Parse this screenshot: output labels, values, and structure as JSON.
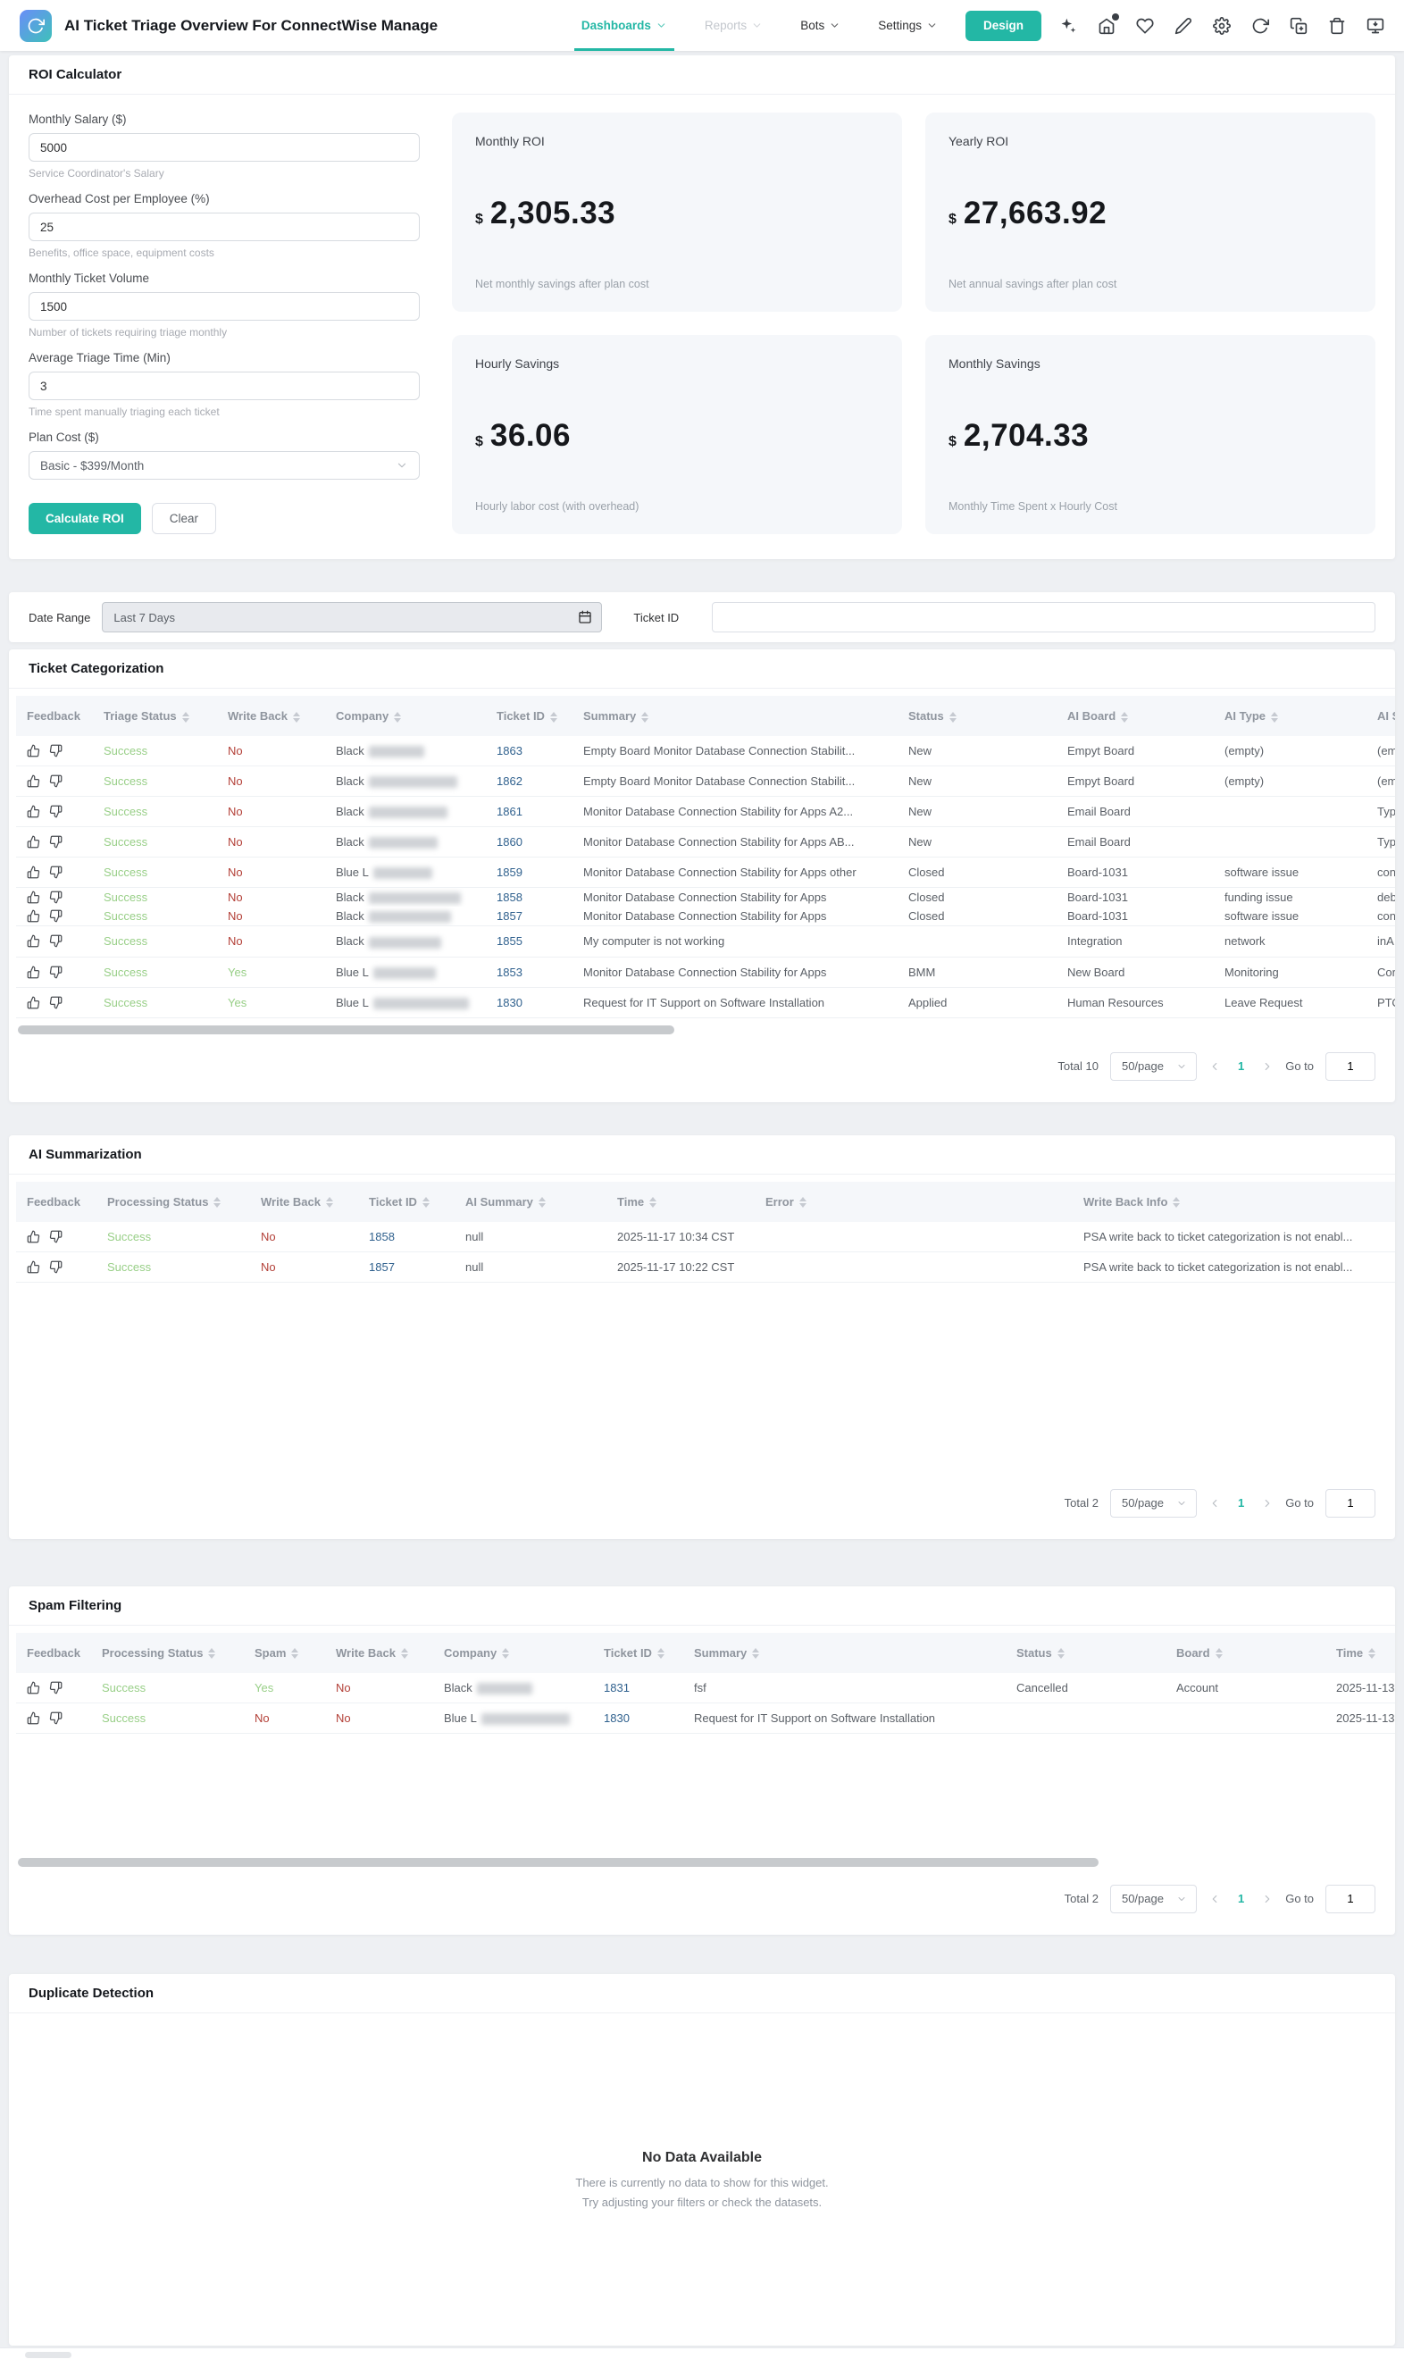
{
  "nav": {
    "title": "AI Ticket Triage Overview For ConnectWise Manage",
    "menus": [
      {
        "label": "Dashboards",
        "state": "active"
      },
      {
        "label": "Reports",
        "state": "disabled"
      },
      {
        "label": "Bots",
        "state": "normal"
      },
      {
        "label": "Settings",
        "state": "normal"
      }
    ],
    "design_button": "Design",
    "icons": [
      "ai-sparkles",
      "home",
      "favorite",
      "edit",
      "settings",
      "refresh",
      "duplicate",
      "trash",
      "present"
    ]
  },
  "roi": {
    "title": "ROI Calculator",
    "fields": [
      {
        "label": "Monthly Salary ($)",
        "value": "5000",
        "helper": "Service Coordinator's Salary"
      },
      {
        "label": "Overhead Cost per Employee (%)",
        "value": "25",
        "helper": "Benefits, office space, equipment costs"
      },
      {
        "label": "Monthly Ticket Volume",
        "value": "1500",
        "helper": "Number of tickets requiring triage monthly"
      },
      {
        "label": "Average Triage Time (Min)",
        "value": "3",
        "helper": "Time spent manually triaging each ticket"
      }
    ],
    "plan": {
      "label": "Plan Cost ($)",
      "value": "Basic - $399/Month"
    },
    "calculate_button": "Calculate ROI",
    "clear_button": "Clear",
    "metrics": [
      {
        "title": "Monthly ROI",
        "currency": "$",
        "value": "2,305.33",
        "caption": "Net monthly savings after plan cost"
      },
      {
        "title": "Yearly ROI",
        "currency": "$",
        "value": "27,663.92",
        "caption": "Net annual savings after plan cost"
      },
      {
        "title": "Hourly Savings",
        "currency": "$",
        "value": "36.06",
        "caption": "Hourly labor cost (with overhead)"
      },
      {
        "title": "Monthly Savings",
        "currency": "$",
        "value": "2,704.33",
        "caption": "Monthly Time Spent x Hourly Cost"
      }
    ]
  },
  "filters": {
    "date_range_label": "Date Range",
    "date_range_value": "Last 7 Days",
    "ticket_id_label": "Ticket ID",
    "ticket_id_value": ""
  },
  "ticket_categorization": {
    "title": "Ticket Categorization",
    "columns": [
      "Feedback",
      "Triage Status",
      "Write Back",
      "Company",
      "Ticket ID",
      "Summary",
      "Status",
      "AI Board",
      "AI Type",
      "AI S"
    ],
    "rows": [
      {
        "triage_status": "Success",
        "write_back": "No",
        "company": "Black",
        "ticket_id": "1863",
        "summary": "Empty Board Monitor Database Connection Stabilit...",
        "status": "New",
        "ai_board": "Empyt Board",
        "ai_type": "(empty)",
        "ai_s": "(em"
      },
      {
        "triage_status": "Success",
        "write_back": "No",
        "company": "Black",
        "ticket_id": "1862",
        "summary": "Empty Board Monitor Database Connection Stabilit...",
        "status": "New",
        "ai_board": "Empyt Board",
        "ai_type": "(empty)",
        "ai_s": "(em"
      },
      {
        "triage_status": "Success",
        "write_back": "No",
        "company": "Black",
        "ticket_id": "1861",
        "summary": "Monitor Database Connection Stability for Apps A2...",
        "status": "New",
        "ai_board": "Email Board",
        "ai_type": "",
        "ai_s": "Typ"
      },
      {
        "triage_status": "Success",
        "write_back": "No",
        "company": "Black",
        "ticket_id": "1860",
        "summary": "Monitor Database Connection Stability for Apps AB...",
        "status": "New",
        "ai_board": "Email Board",
        "ai_type": "",
        "ai_s": "Typ"
      },
      {
        "triage_status": "Success",
        "write_back": "No",
        "company": "Blue L",
        "ticket_id": "1859",
        "summary": "Monitor Database Connection Stability for Apps other",
        "status": "Closed",
        "ai_board": "Board-1031",
        "ai_type": "software issue",
        "ai_s": "con"
      },
      {
        "triage_status": "Success",
        "write_back": "No",
        "company": "Black",
        "ticket_id": "1858",
        "summary": "Monitor Database Connection Stability for Apps",
        "status": "Closed",
        "ai_board": "Board-1031",
        "ai_type": "funding issue",
        "ai_s": "deb"
      },
      {
        "triage_status": "Success",
        "write_back": "No",
        "company": "Black",
        "ticket_id": "1857",
        "summary": "Monitor Database Connection Stability for Apps",
        "status": "Closed",
        "ai_board": "Board-1031",
        "ai_type": "software issue",
        "ai_s": "con"
      },
      {
        "triage_status": "Success",
        "write_back": "No",
        "company": "Black",
        "ticket_id": "1855",
        "summary": "My computer is not working",
        "status": "",
        "ai_board": "Integration",
        "ai_type": "network",
        "ai_s": "inA"
      },
      {
        "triage_status": "Success",
        "write_back": "Yes",
        "company": "Blue L",
        "ticket_id": "1853",
        "summary": "Monitor Database Connection Stability for Apps",
        "status": "BMM",
        "ai_board": "New Board",
        "ai_type": "Monitoring",
        "ai_s": "Cor"
      },
      {
        "triage_status": "Success",
        "write_back": "Yes",
        "company": "Blue L",
        "ticket_id": "1830",
        "summary": "Request for IT Support on Software Installation",
        "status": "Applied",
        "ai_board": "Human Resources",
        "ai_type": "Leave Request",
        "ai_s": "PTO"
      }
    ],
    "pagination": {
      "total": "Total 10",
      "page_size": "50/page",
      "page": "1",
      "goto_label": "Go to",
      "goto_value": "1"
    }
  },
  "ai_summarization": {
    "title": "AI Summarization",
    "columns": [
      "Feedback",
      "Processing Status",
      "Write Back",
      "Ticket ID",
      "AI Summary",
      "Time",
      "Error",
      "Write Back Info"
    ],
    "rows": [
      {
        "processing_status": "Success",
        "write_back": "No",
        "ticket_id": "1858",
        "ai_summary": "null",
        "time": "2025-11-17 10:34 CST",
        "error": "",
        "write_back_info": "PSA write back to ticket categorization is not enabl..."
      },
      {
        "processing_status": "Success",
        "write_back": "No",
        "ticket_id": "1857",
        "ai_summary": "null",
        "time": "2025-11-17 10:22 CST",
        "error": "",
        "write_back_info": "PSA write back to ticket categorization is not enabl..."
      }
    ],
    "pagination": {
      "total": "Total 2",
      "page_size": "50/page",
      "page": "1",
      "goto_label": "Go to",
      "goto_value": "1"
    }
  },
  "spam_filtering": {
    "title": "Spam Filtering",
    "columns": [
      "Feedback",
      "Processing Status",
      "Spam",
      "Write Back",
      "Company",
      "Ticket ID",
      "Summary",
      "Status",
      "Board",
      "Time"
    ],
    "rows": [
      {
        "processing_status": "Success",
        "spam": "Yes",
        "write_back": "No",
        "company": "Black",
        "ticket_id": "1831",
        "summary": "fsf",
        "status": "Cancelled",
        "board": "Account",
        "time": "2025-11-13 1"
      },
      {
        "processing_status": "Success",
        "spam": "No",
        "write_back": "No",
        "company": "Blue L",
        "ticket_id": "1830",
        "summary": "Request for IT Support on Software Installation",
        "status": "",
        "board": "",
        "time": "2025-11-13 1"
      }
    ],
    "pagination": {
      "total": "Total 2",
      "page_size": "50/page",
      "page": "1",
      "goto_label": "Go to",
      "goto_value": "1"
    }
  },
  "duplicate_detection": {
    "title": "Duplicate Detection",
    "empty_title": "No Data Available",
    "empty_line1": "There is currently no data to show for this widget.",
    "empty_line2": "Try adjusting your filters or check the datasets."
  }
}
